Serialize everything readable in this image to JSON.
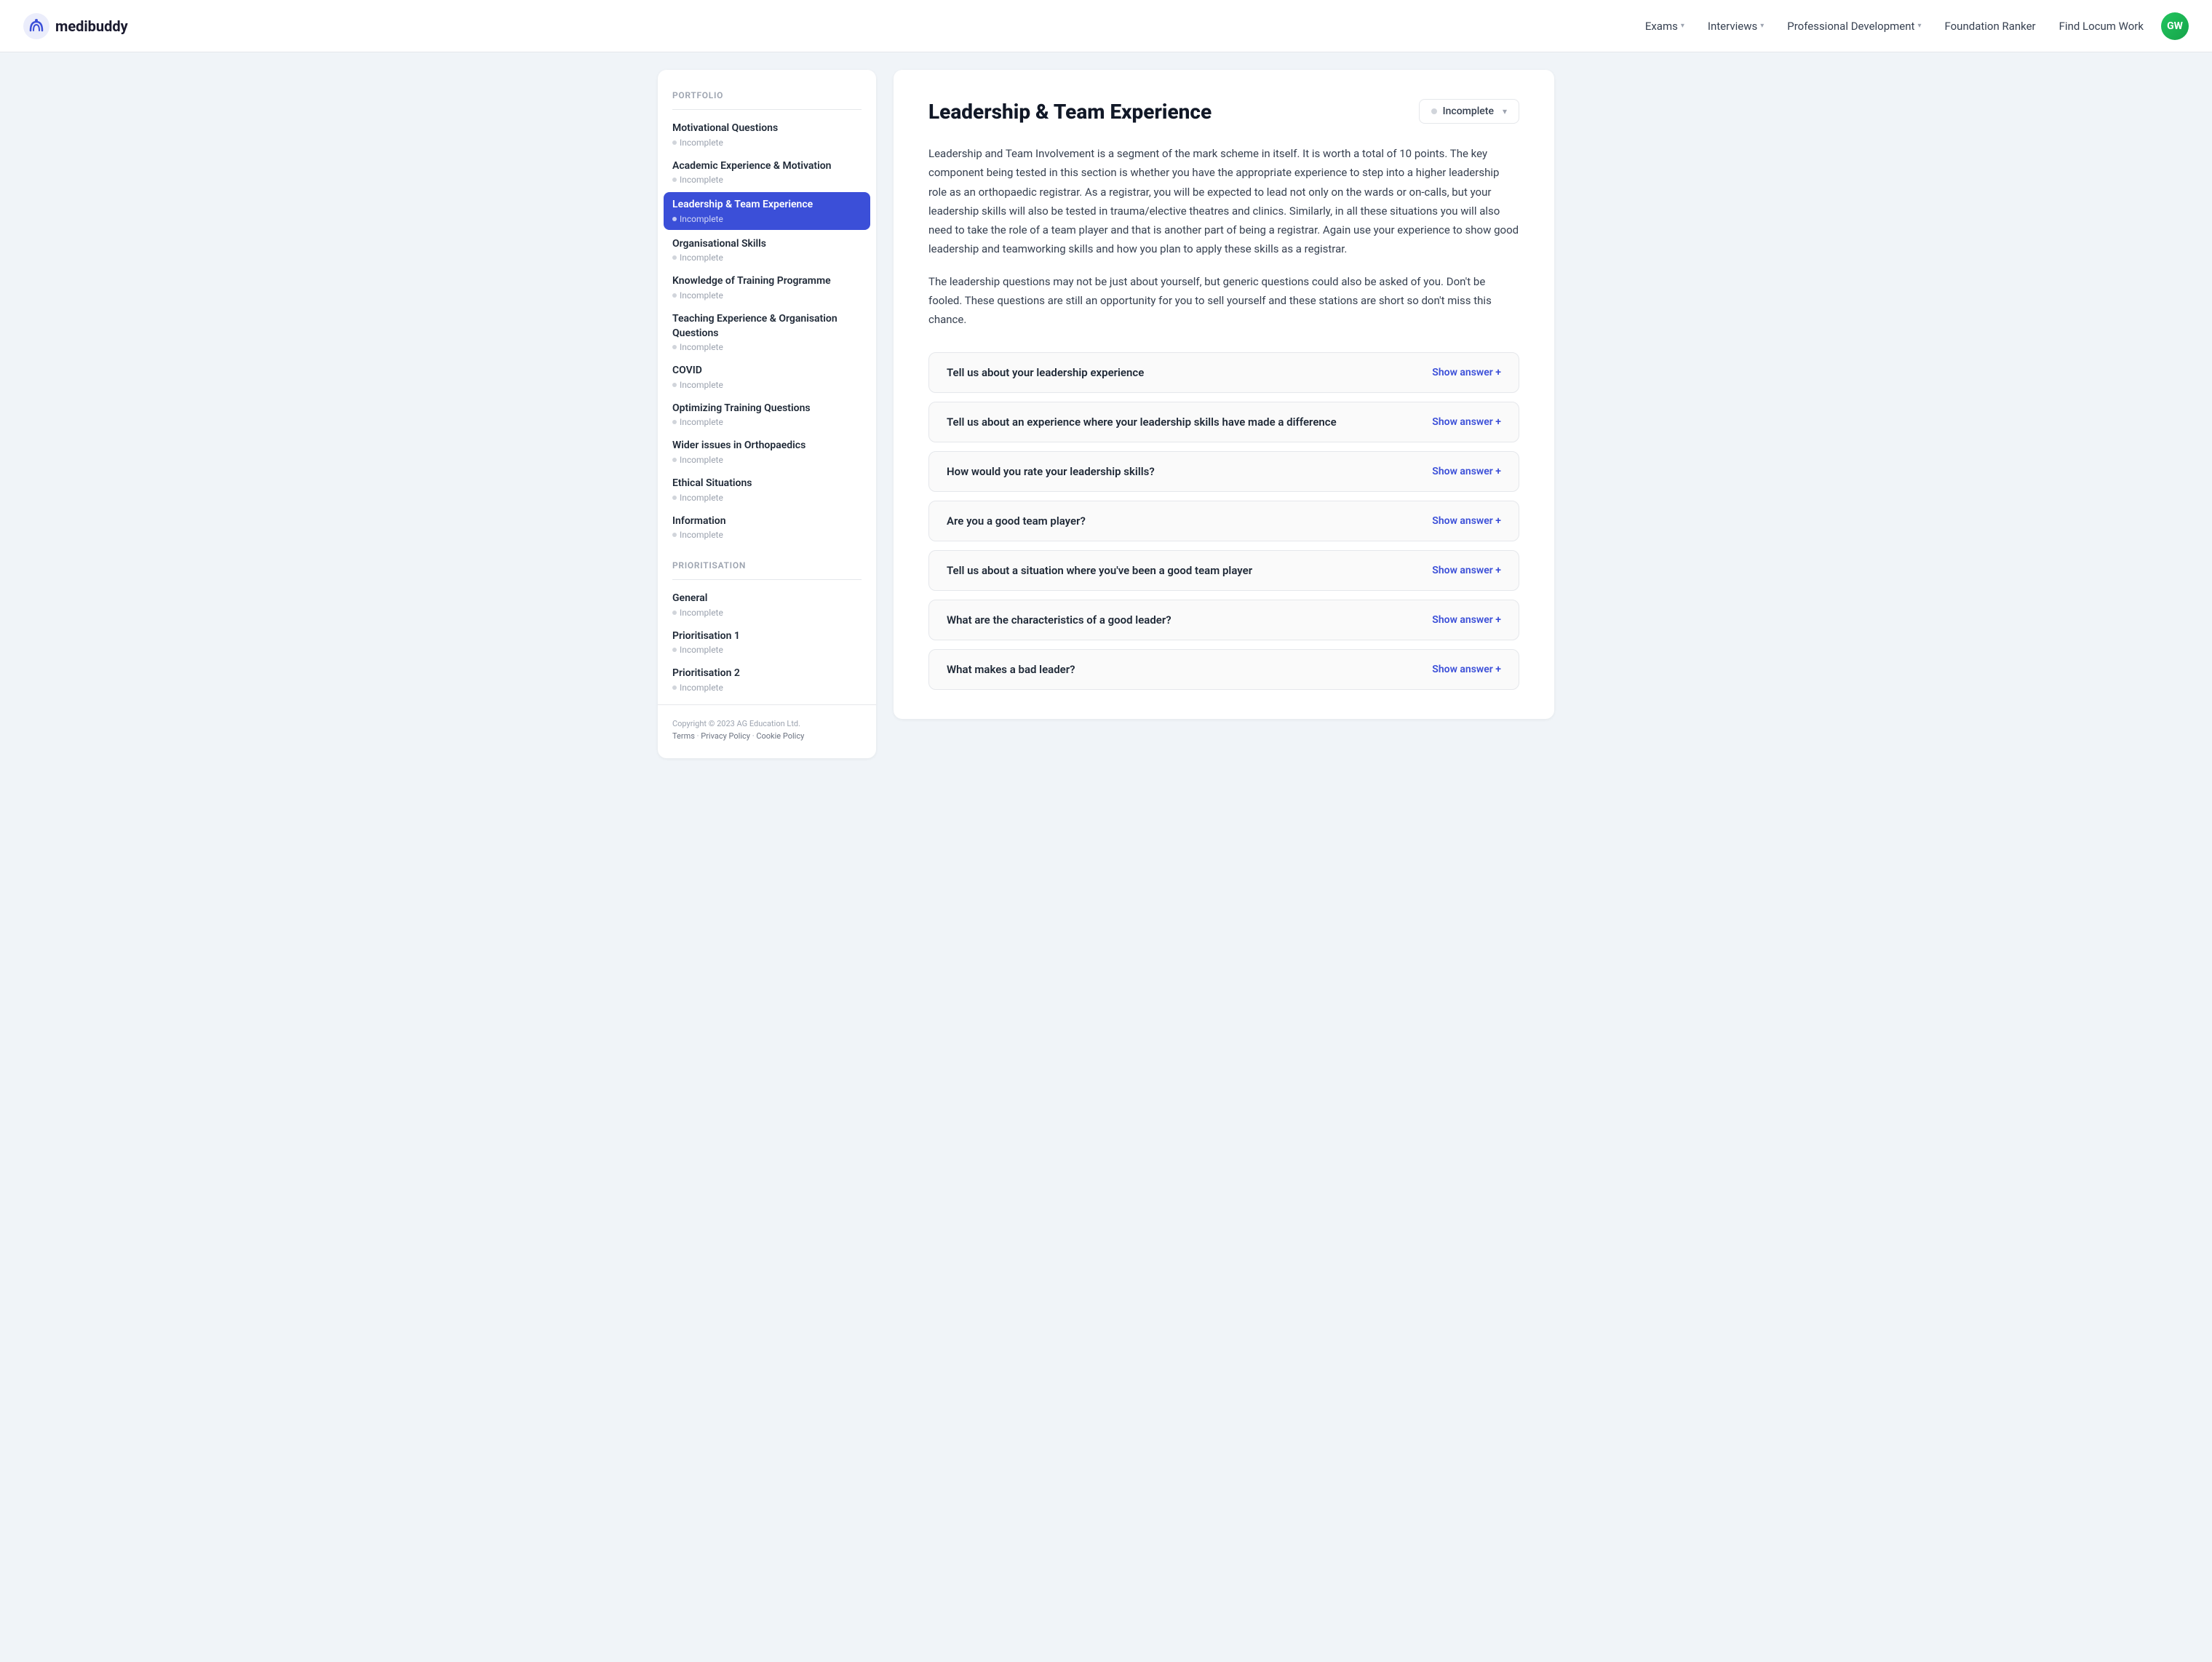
{
  "navbar": {
    "logo_text": "medibuddy",
    "avatar_initials": "GW",
    "links": [
      {
        "label": "Exams",
        "has_dropdown": true
      },
      {
        "label": "Interviews",
        "has_dropdown": true
      },
      {
        "label": "Professional Development",
        "has_dropdown": true
      },
      {
        "label": "Foundation Ranker",
        "has_dropdown": false
      },
      {
        "label": "Find Locum Work",
        "has_dropdown": false
      }
    ]
  },
  "sidebar": {
    "section1_label": "Portfolio",
    "section2_label": "Prioritisation",
    "items_portfolio": [
      {
        "title": "Motivational Questions",
        "status": "Incomplete",
        "active": false
      },
      {
        "title": "Academic Experience & Motivation",
        "status": "Incomplete",
        "active": false
      },
      {
        "title": "Leadership & Team Experience",
        "status": "Incomplete",
        "active": true
      },
      {
        "title": "Organisational Skills",
        "status": "Incomplete",
        "active": false
      },
      {
        "title": "Knowledge of Training Programme",
        "status": "Incomplete",
        "active": false
      },
      {
        "title": "Teaching Experience & Organisation Questions",
        "status": "Incomplete",
        "active": false
      },
      {
        "title": "COVID",
        "status": "Incomplete",
        "active": false
      },
      {
        "title": "Optimizing Training Questions",
        "status": "Incomplete",
        "active": false
      },
      {
        "title": "Wider issues in Orthopaedics",
        "status": "Incomplete",
        "active": false
      },
      {
        "title": "Ethical Situations",
        "status": "Incomplete",
        "active": false
      },
      {
        "title": "Information",
        "status": "Incomplete",
        "active": false
      }
    ],
    "items_prioritisation": [
      {
        "title": "General",
        "status": "Incomplete",
        "active": false
      },
      {
        "title": "Prioritisation 1",
        "status": "Incomplete",
        "active": false
      },
      {
        "title": "Prioritisation 2",
        "status": "Incomplete",
        "active": false
      }
    ],
    "copyright": "Copyright © 2023 AG Education Ltd.",
    "footer_links": [
      "Terms",
      "Privacy Policy",
      "Cookie Policy"
    ]
  },
  "main": {
    "title": "Leadership & Team Experience",
    "status_label": "Incomplete",
    "description_1": "Leadership and Team Involvement is a segment of the mark scheme in itself. It is worth a total of 10 points. The key component being tested in this section is whether you have the appropriate experience to step into a higher leadership role as an orthopaedic registrar. As a registrar, you will be expected to lead not only on the wards or on-calls, but your leadership skills will also be tested in trauma/elective theatres and clinics. Similarly, in all these situations you will also need to take the role of a team player and that is another part of being a registrar. Again use your experience to show good leadership and teamworking skills and how you plan to apply these skills as a registrar.",
    "description_2": "The leadership questions may not be just about yourself, but generic questions could also be asked of you. Don't be fooled. These questions are still an opportunity for you to sell yourself and these stations are short so don't miss this chance.",
    "questions": [
      {
        "text": "Tell us about your leadership experience",
        "btn_label": "Show answer +"
      },
      {
        "text": "Tell us about an experience where your leadership skills have made a difference",
        "btn_label": "Show answer +"
      },
      {
        "text": "How would you rate your leadership skills?",
        "btn_label": "Show answer +"
      },
      {
        "text": "Are you a good team player?",
        "btn_label": "Show answer +"
      },
      {
        "text": "Tell us about a situation where you've been a good team player",
        "btn_label": "Show answer +"
      },
      {
        "text": "What are the characteristics of a good leader?",
        "btn_label": "Show answer +"
      },
      {
        "text": "What makes a bad leader?",
        "btn_label": "Show answer +"
      }
    ]
  }
}
